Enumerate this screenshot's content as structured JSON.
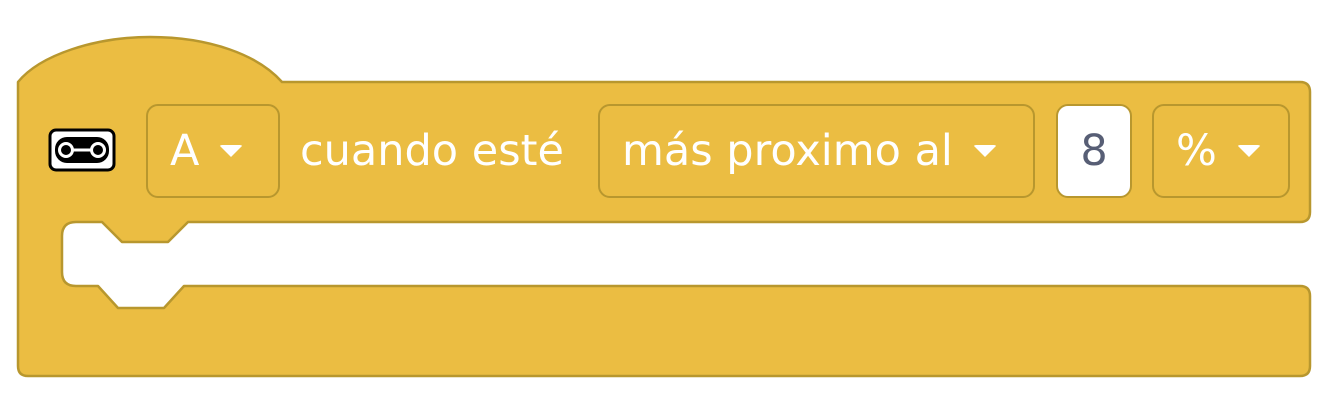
{
  "block": {
    "port_dropdown": {
      "value": "A"
    },
    "static_text": "cuando esté",
    "condition_dropdown": {
      "value": "más proximo al"
    },
    "value_input": {
      "value": "8"
    },
    "unit_dropdown": {
      "value": "%"
    },
    "icon": "distance-sensor-icon"
  },
  "colors": {
    "block_fill": "#EBBD42",
    "block_border": "#B8972E",
    "text": "#FFFFFF",
    "input_text": "#575E75"
  }
}
